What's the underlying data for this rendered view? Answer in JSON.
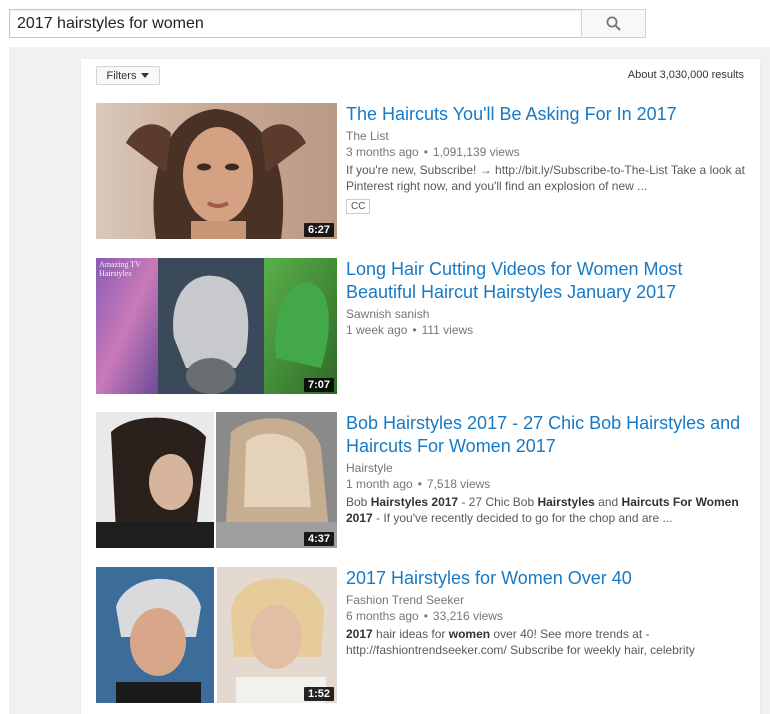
{
  "search": {
    "query": "2017 hairstyles for women",
    "icon": "search-icon"
  },
  "toolbar": {
    "filters_label": "Filters",
    "results_count": "About 3,030,000 results"
  },
  "results": [
    {
      "title": "The Haircuts You'll Be Asking For In 2017",
      "channel": "The List",
      "age": "3 months ago",
      "views": "1,091,139 views",
      "desc_html": "If you're new, Subscribe! → http://bit.ly/Subscribe-to-The-List Take a look at Pinterest right now, and you'll find an explosion of new ...",
      "badge": "CC",
      "duration": "6:27"
    },
    {
      "title": "Long Hair Cutting Videos for Women Most Beautiful Haircut Hairstyles January 2017",
      "channel": "Sawnish sanish",
      "age": "1 week ago",
      "views": "111 views",
      "duration": "7:07",
      "thumb_watermark": "Amazing TV Hairstyles"
    },
    {
      "title": "Bob Hairstyles 2017 - 27 Chic Bob Hairstyles and Haircuts For Women 2017",
      "channel": "Hairstyle",
      "age": "1 month ago",
      "views": "7,518 views",
      "desc_html": "Bob <b>Hairstyles 2017</b> - 27 Chic Bob <b>Hairstyles</b> and <b>Haircuts For Women 2017</b> - If you've recently decided to go for the chop and are ...",
      "duration": "4:37"
    },
    {
      "title": "2017 Hairstyles for Women Over 40",
      "channel": "Fashion Trend Seeker",
      "age": "6 months ago",
      "views": "33,216 views",
      "desc_html": "<b>2017</b> hair ideas for <b>women</b> over 40! See more trends at - http://fashiontrendseeker.com/ Subscribe for weekly hair, celebrity",
      "duration": "1:52"
    }
  ],
  "colors": {
    "link": "#167ac6",
    "meta": "#767676",
    "page_bg": "#f1f1f1"
  }
}
